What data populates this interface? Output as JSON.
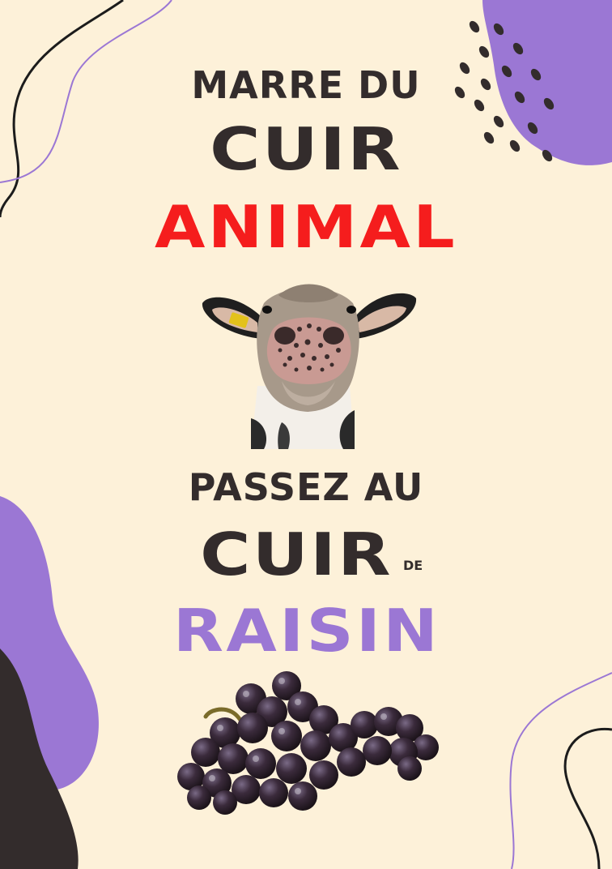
{
  "headline": {
    "line1": "MARRE DU",
    "line2": "CUIR",
    "line3": "ANIMAL",
    "line4": "PASSEZ AU",
    "line5": "CUIR",
    "line5_small": "DE",
    "line6": "RAISIN"
  },
  "colors": {
    "background": "#fdf1d9",
    "dark_text": "#332c2c",
    "red_accent": "#f51d1d",
    "purple_accent": "#9b77d4"
  },
  "images": {
    "top": "cow-face-icon",
    "bottom": "grapes-icon"
  }
}
